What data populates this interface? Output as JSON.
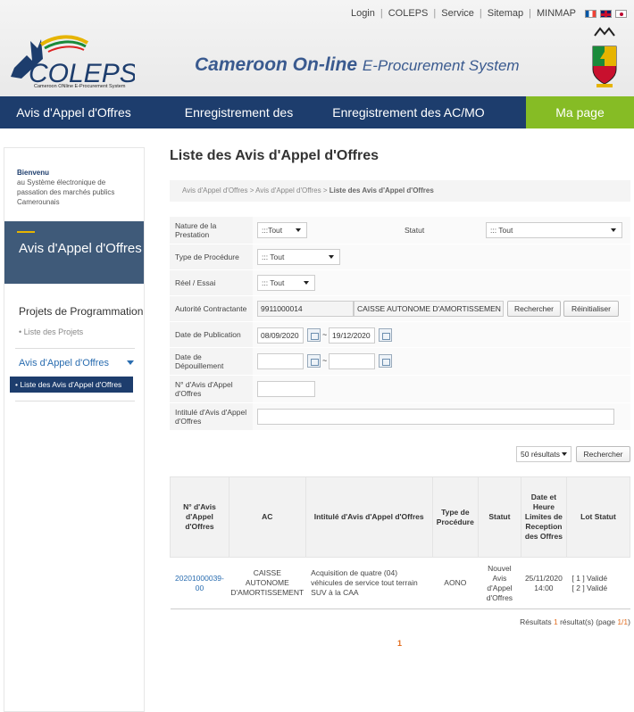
{
  "header": {
    "top_links": [
      "Login",
      "COLEPS",
      "Service",
      "Sitemap",
      "MINMAP"
    ],
    "logo_text": "COLEPS",
    "logo_subtitle": "Cameroon ONline E-Procurement System",
    "title_bold": "Cameroon On-line",
    "title_rest": "E-Procurement System"
  },
  "nav": {
    "items": [
      "Avis d'Appel d'Offres",
      "Enregistrement des soumissionnaires",
      "Enregistrement des AC/MO"
    ],
    "my_page": "Ma page"
  },
  "sidebar": {
    "welcome_title": "Bienvenu",
    "welcome_text": "au Système électronique de passation des marchés publics Camerounais",
    "banner": "Avis d'Appel d'Offres",
    "section_programmation": "Projets de Programmation",
    "link_projets": "• Liste des Projets",
    "section_ao": "Avis d'Appel d'Offres",
    "active_item": "• Liste des Avis d'Appel d'Offres"
  },
  "main": {
    "title": "Liste des Avis d'Appel d'Offres",
    "breadcrumb_1": "Avis d'Appel d'Offres",
    "breadcrumb_sep": " > ",
    "breadcrumb_2": "Avis d'Appel d'Offres",
    "breadcrumb_3": "Liste des Avis d'Appel d'Offres"
  },
  "form": {
    "nature_label": "Nature de la Prestation",
    "nature_value": ":::Tout",
    "statut_label": "Statut",
    "statut_value": "::: Tout",
    "type_label": "Type de Procédure",
    "type_value": "::: Tout",
    "reel_label": "Réel / Essai",
    "reel_value": "::: Tout",
    "autorite_label": "Autorité Contractante",
    "autorite_code": "9911000014",
    "autorite_name": "CAISSE AUTONOME D'AMORTISSEMEN",
    "btn_rechercher": "Rechercher",
    "btn_reinit": "Réinitialiser",
    "publication_label": "Date de Publication",
    "pub_from": "08/09/2020",
    "pub_to": "19/12/2020",
    "date_sep": "~",
    "depouillement_label": "Date de Dépouillement",
    "dep_from": "",
    "dep_to": "",
    "numero_label": "N° d'Avis d'Appel d'Offres",
    "numero_value": "",
    "intitule_label": "Intitulé d'Avis d'Appel d'Offres",
    "intitule_value": ""
  },
  "results": {
    "per_page": "50 résultats",
    "search_btn": "Rechercher",
    "summary_prefix": "Résultats",
    "summary_count": "1",
    "summary_mid": "résultat(s) (page",
    "summary_page": "1/1",
    "summary_end": ")",
    "page": "1"
  },
  "table": {
    "headers": [
      "N° d'Avis d'Appel d'Offres",
      "AC",
      "Intitulé d'Avis d'Appel d'Offres",
      "Type de Procédure",
      "Statut",
      "Date et Heure Limites de Reception des Offres",
      "Lot Statut"
    ],
    "rows": [
      {
        "numero": "20201000039-00",
        "ac": "CAISSE AUTONOME D'AMORTISSEMENT",
        "intitule": "Acquisition de quatre (04) véhicules de service tout terrain SUV à la CAA",
        "type": "AONO",
        "statut": "Nouvel Avis d'Appel d'Offres",
        "date": "25/11/2020 14:00",
        "lot_1": "[ 1 ] Validé",
        "lot_2": "[ 2 ] Validé"
      }
    ]
  }
}
